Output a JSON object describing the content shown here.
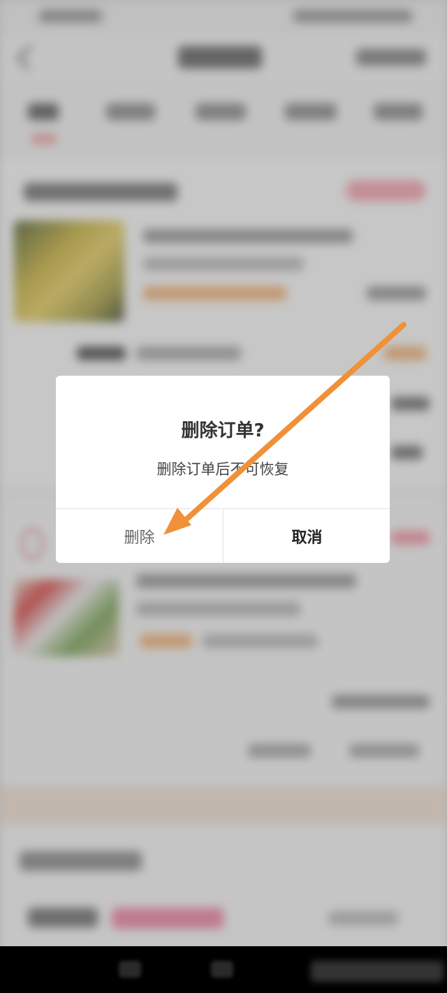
{
  "dialog": {
    "title": "删除订单?",
    "message": "删除订单后不可恢复",
    "delete_label": "删除",
    "cancel_label": "取消"
  },
  "annotation": {
    "icon": "pointer-arrow-icon",
    "color": "#f0913a"
  },
  "colors": {
    "dialog_background": "#ffffff",
    "overlay": "#5a5a5a",
    "navbar": "#000000"
  }
}
